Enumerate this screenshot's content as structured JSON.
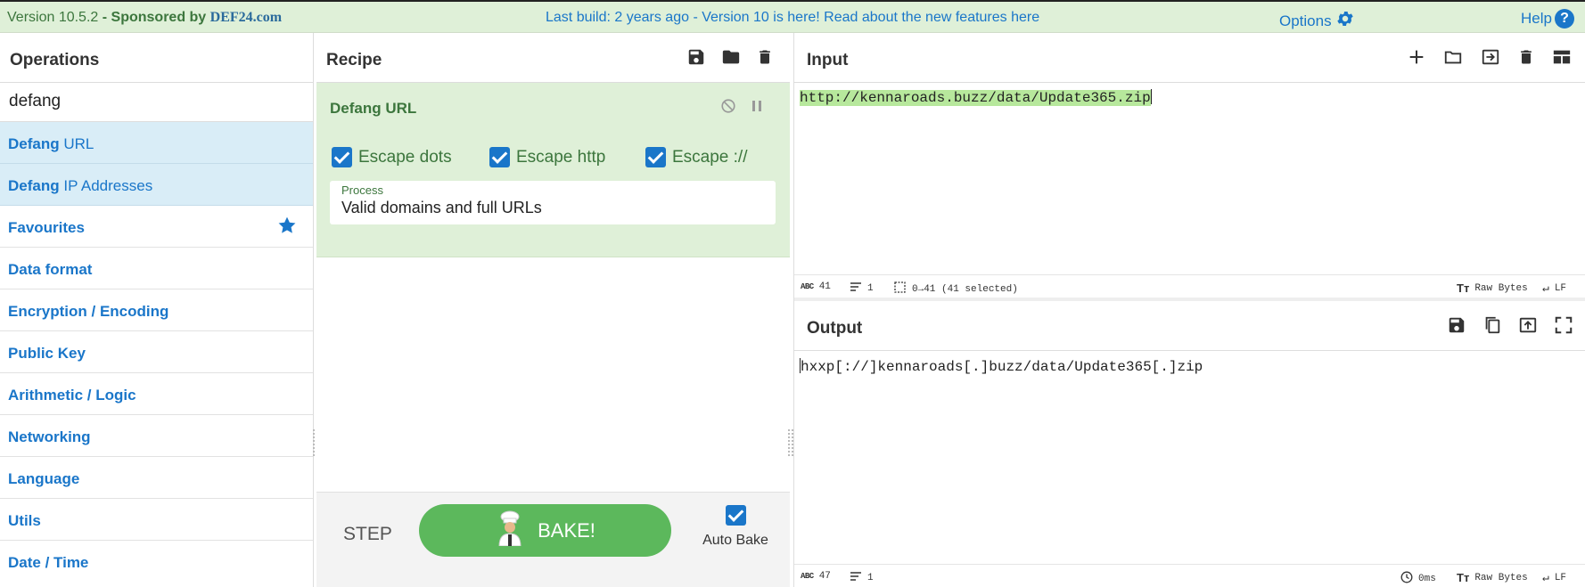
{
  "banner": {
    "version": "Version 10.5.2",
    "sponsored_prefix": "- Sponsored by",
    "sponsor": "DEF24.com",
    "build_notice": "Last build: 2 years ago - Version 10 is here! Read about the new features here",
    "options_label": "Options",
    "help_label": "Help",
    "help_glyph": "?"
  },
  "operations": {
    "title": "Operations",
    "search_value": "defang",
    "results": [
      {
        "match": "Defang",
        "rest": " URL"
      },
      {
        "match": "Defang",
        "rest": " IP Addresses"
      }
    ],
    "categories": [
      "Favourites",
      "Data format",
      "Encryption / Encoding",
      "Public Key",
      "Arithmetic / Logic",
      "Networking",
      "Language",
      "Utils",
      "Date / Time"
    ]
  },
  "recipe": {
    "title": "Recipe",
    "operation": {
      "name": "Defang URL",
      "options": [
        {
          "label": "Escape dots",
          "checked": true
        },
        {
          "label": "Escape http",
          "checked": true
        },
        {
          "label": "Escape ://",
          "checked": true
        }
      ],
      "process_label": "Process",
      "process_value": "Valid domains and full URLs"
    },
    "step_label": "STEP",
    "bake_label": "BAKE!",
    "auto_bake_label": "Auto Bake",
    "auto_bake_checked": true
  },
  "input": {
    "title": "Input",
    "text": "http://kennaroads.buzz/data/Update365.zip",
    "status": {
      "abc": "ABC",
      "chars": "41",
      "lines": "1",
      "selection": "0→41 (41 selected)",
      "encoding": "Raw Bytes",
      "eol": "LF"
    }
  },
  "output": {
    "title": "Output",
    "text": "hxxp[://]kennaroads[.]buzz/data/Update365[.]zip",
    "status": {
      "abc": "ABC",
      "chars": "47",
      "lines": "1",
      "time": "0ms",
      "encoding": "Raw Bytes",
      "eol": "LF"
    }
  },
  "colors": {
    "banner_bg": "#dff0d8",
    "accent_blue": "#1a76c9",
    "green_text": "#3c763d",
    "bake_green": "#5cb85c",
    "highlight_bg": "#d9edf7",
    "selection_bg": "#b7e89c"
  }
}
